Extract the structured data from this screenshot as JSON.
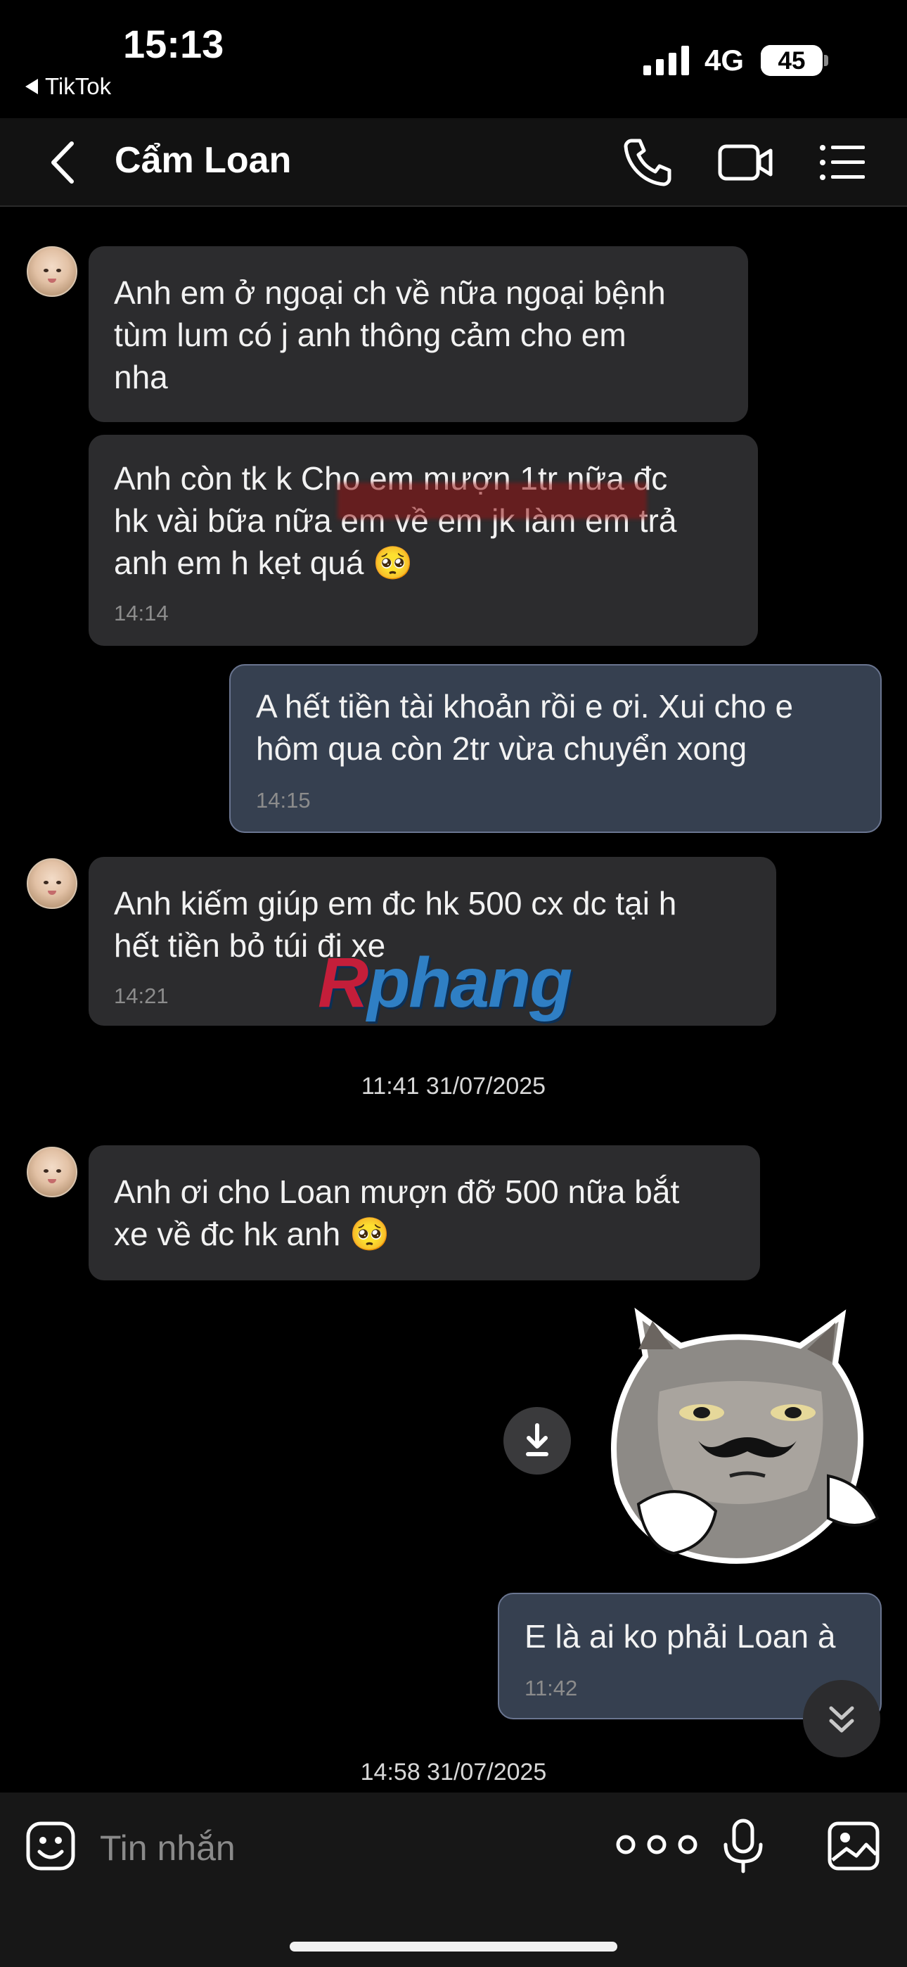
{
  "status_bar": {
    "time": "15:13",
    "back_app": "TikTok",
    "network": "4G",
    "battery": "45",
    "battery_level": 0.45
  },
  "header": {
    "title": "Cẩm Loan"
  },
  "messages": [
    {
      "side": "in",
      "text": "Anh em ở ngoại ch về nữa ngoại bệnh\ntùm lum có j anh thông cảm cho em\nnha",
      "time": ""
    },
    {
      "side": "in",
      "text": "Anh còn tk k Cho em mượn 1tr nữa đc\nhk vài bữa nữa em về em jk làm em trả\nanh em h kẹt quá 🥺",
      "time": "14:14"
    },
    {
      "side": "out",
      "text": "A hết tiền tài khoản rồi e ơi. Xui cho e\nhôm qua còn 2tr vừa chuyển xong",
      "time": "14:15"
    },
    {
      "side": "in",
      "text": "Anh kiếm giúp em đc hk 500 cx dc tại h\nhết tiền bỏ túi đi xe",
      "time": "14:21"
    },
    {
      "side": "in",
      "text": "Anh ơi cho Loan mượn đỡ 500 nữa bắt\nxe về đc hk anh 🥺",
      "time": ""
    },
    {
      "side": "out",
      "text": "E là ai ko phải Loan à",
      "time": "11:42"
    }
  ],
  "separators": [
    "11:41 31/07/2025",
    "14:58 31/07/2025"
  ],
  "watermark": {
    "first": "R",
    "rest": "phang"
  },
  "input": {
    "placeholder": "Tin nhắn"
  },
  "icons": {
    "back": "chevron-left-icon",
    "call": "phone-icon",
    "video": "video-camera-icon",
    "menu": "list-icon",
    "download": "download-icon",
    "scroll_down": "double-chevron-down-icon",
    "emoji": "emoji-icon",
    "more": "more-dots-icon",
    "mic": "microphone-icon",
    "image": "image-icon"
  },
  "colors": {
    "incoming_bubble": "#2c2c2e",
    "outgoing_bubble": "#364050",
    "background": "#000000"
  }
}
